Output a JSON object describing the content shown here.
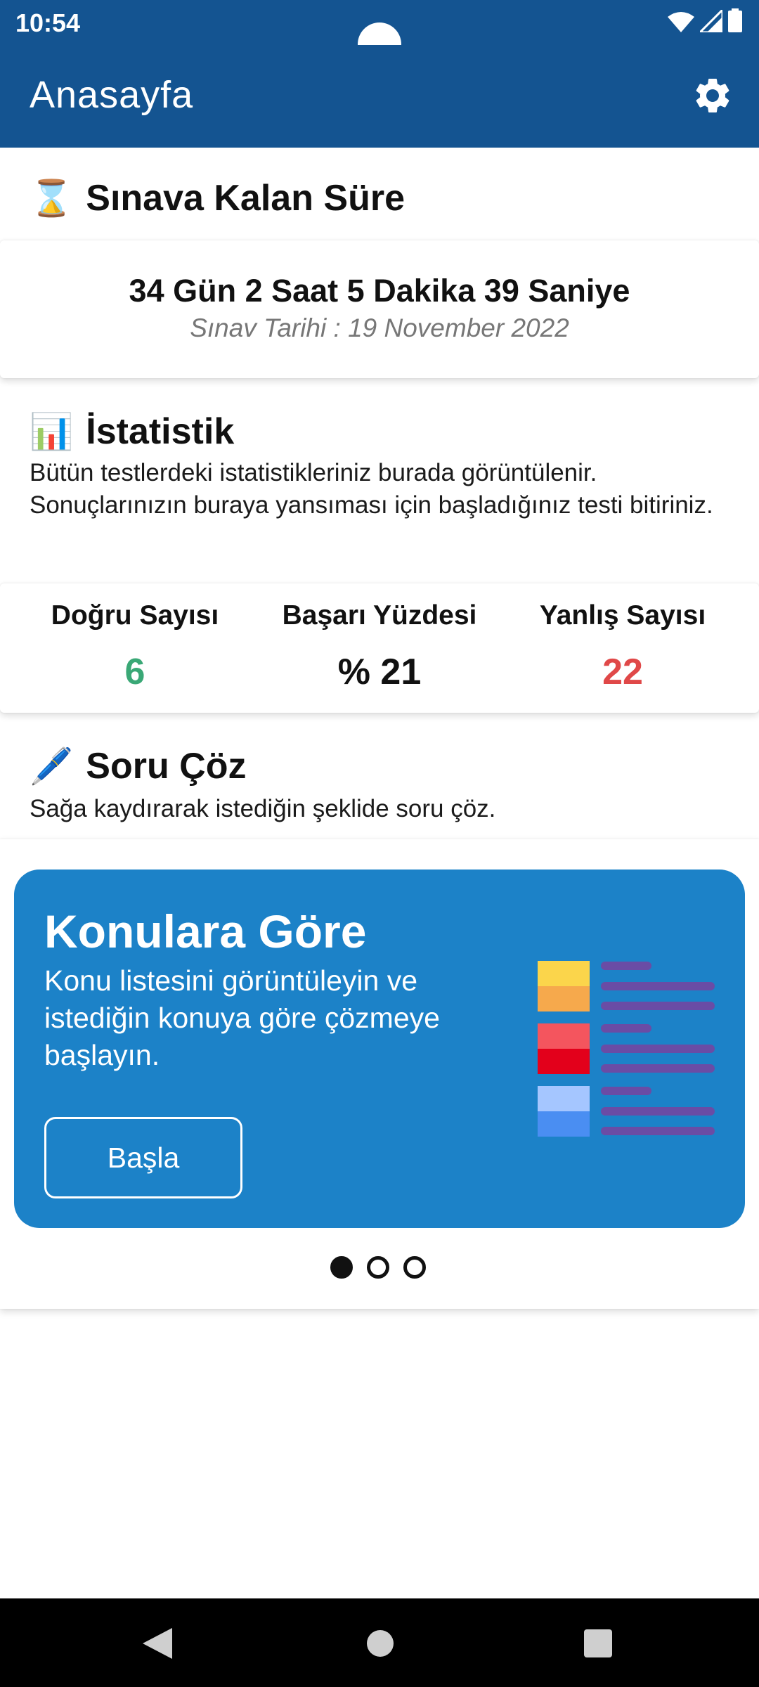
{
  "status_bar": {
    "time": "10:54"
  },
  "app_bar": {
    "title": "Anasayfa",
    "settings_icon": "gear-icon"
  },
  "countdown_section": {
    "heading": "Sınava Kalan Süre",
    "icon": "⌛",
    "countdown": "34 Gün 2 Saat 5 Dakika 39 Saniye",
    "exam_date": "Sınav Tarihi : 19 November 2022"
  },
  "stats_section": {
    "heading": "İstatistik",
    "icon": "📊",
    "description": "Bütün testlerdeki istatistikleriniz burada görüntülenir. Sonuçlarınızın buraya yansıması için başladığınız testi bitiriniz.",
    "correct_label": "Doğru Sayısı",
    "correct_value": "6",
    "success_label": "Başarı Yüzdesi",
    "success_value": "% 21",
    "wrong_label": "Yanlış Sayısı",
    "wrong_value": "22"
  },
  "solve_section": {
    "heading": "Soru Çöz",
    "icon": "🖊️",
    "description": "Sağa kaydırarak istediğin şeklide soru çöz."
  },
  "slider": {
    "title": "Konulara Göre",
    "description": "Konu listesini görüntüleyin ve istediğin konuya göre çözmeye başlayın.",
    "button_label": "Başla",
    "page_count": 3,
    "active_page": 1
  },
  "colors": {
    "primary": "#145491",
    "card_blue": "#1c82c8",
    "correct_green": "#3aa876",
    "wrong_red": "#e04848"
  }
}
